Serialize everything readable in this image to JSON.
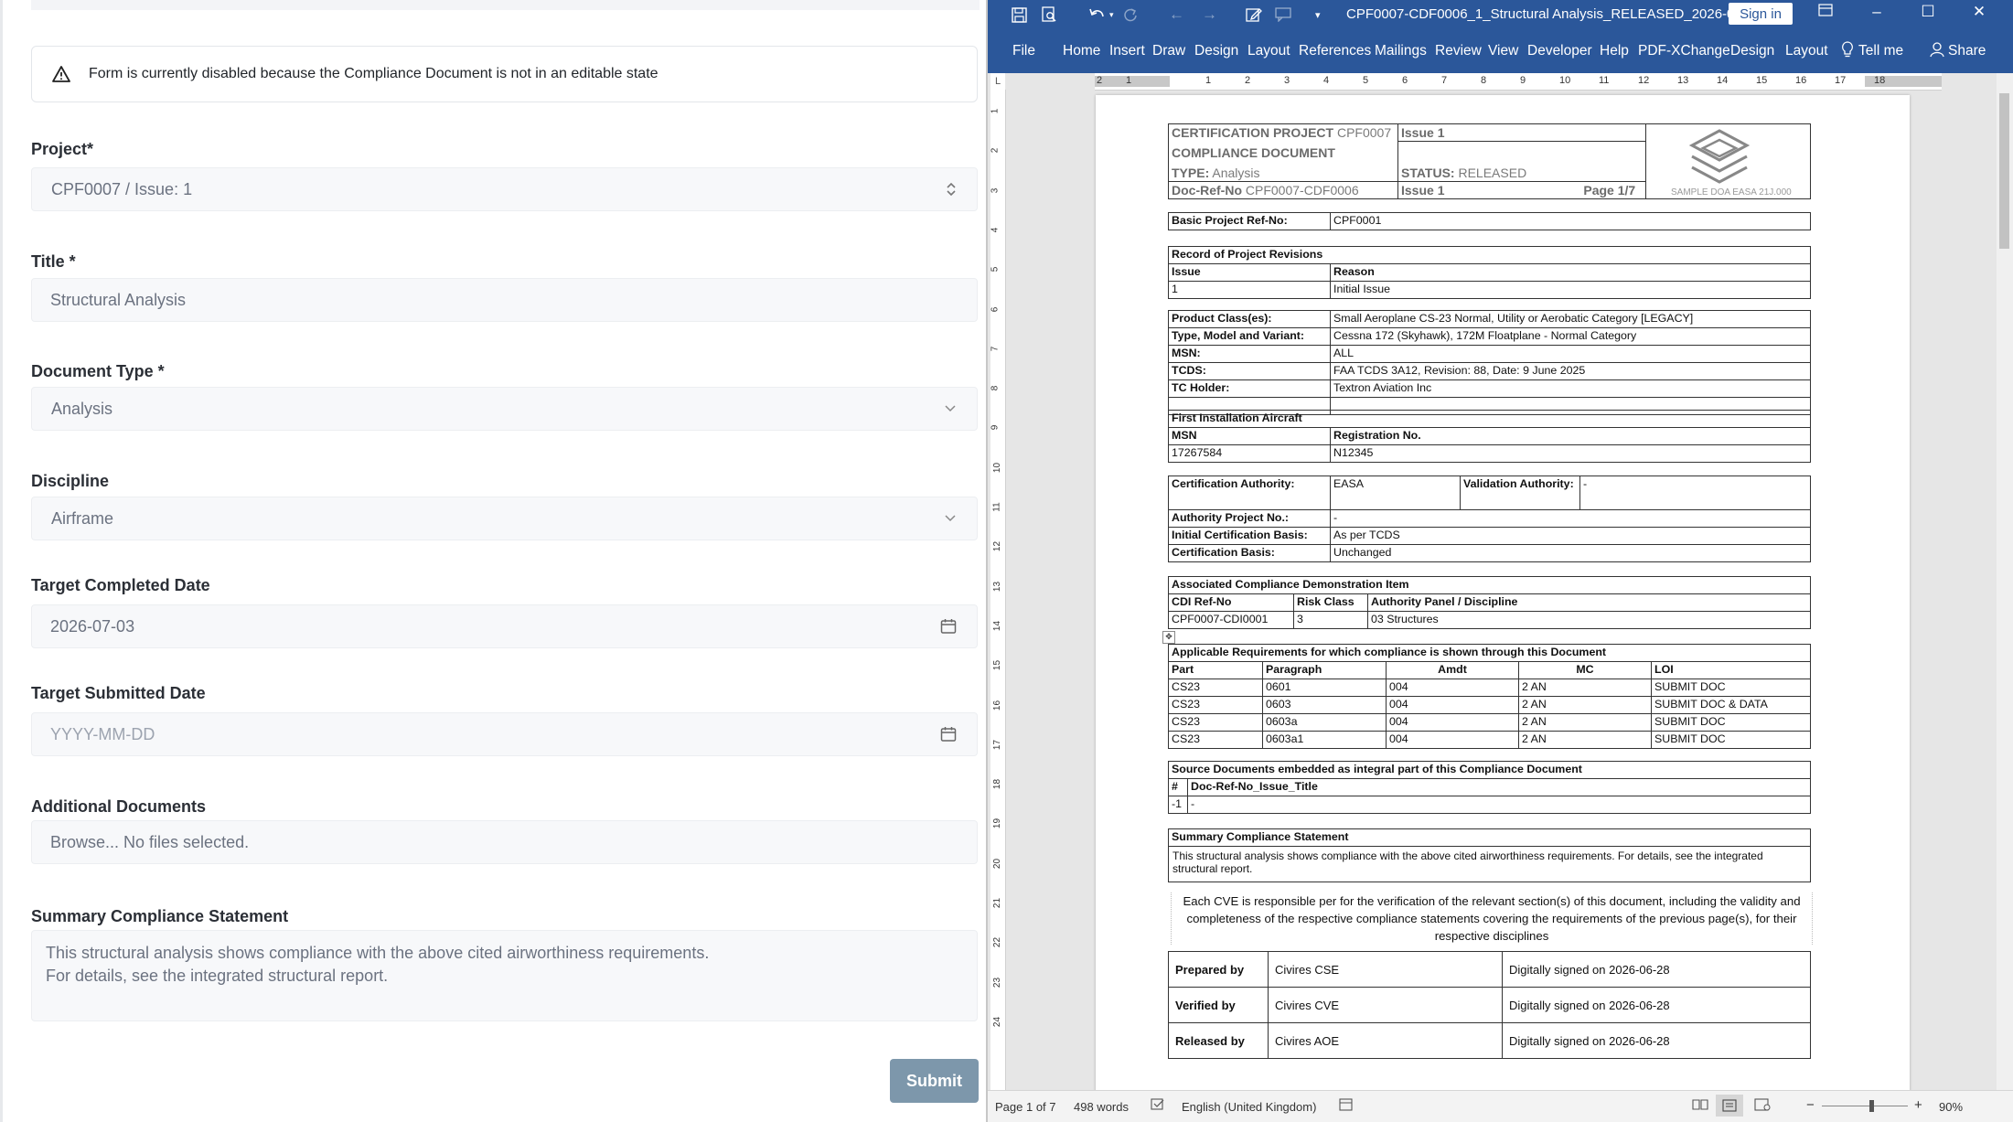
{
  "form": {
    "alert_text": "Form is currently disabled because the Compliance Document is not in an editable state",
    "project_label": "Project*",
    "project_value": "CPF0007 / Issue: 1",
    "title_label": "Title *",
    "title_value": "Structural Analysis",
    "doctype_label": "Document Type *",
    "doctype_value": "Analysis",
    "discipline_label": "Discipline",
    "discipline_value": "Airframe",
    "tcd_label": "Target Completed Date",
    "tcd_value": "2026-07-03",
    "tsd_label": "Target Submitted Date",
    "tsd_placeholder": "YYYY-MM-DD",
    "addl_label": "Additional Documents",
    "addl_value": "Browse... No files selected.",
    "summary_label": "Summary Compliance Statement",
    "summary_value": "This structural analysis shows compliance with the above cited airworthiness requirements.\nFor details, see the integrated structural report.",
    "submit_label": "Submit"
  },
  "word": {
    "doc_title": "CPF0007-CDF0006_1_Structural Analysis_RELEASED_2026-0...",
    "sign_in": "Sign in",
    "tabs": [
      "File",
      "Home",
      "Insert",
      "Draw",
      "Design",
      "Layout",
      "References",
      "Mailings",
      "Review",
      "View",
      "Developer",
      "Help",
      "PDF-XChange",
      "Design",
      "Layout"
    ],
    "tell_me": "Tell me",
    "share": "Share",
    "status": {
      "page": "Page 1 of 7",
      "words": "498 words",
      "language": "English (United Kingdom)",
      "zoom": "90%"
    },
    "ruler_h": [
      "2",
      "1",
      "1",
      "2",
      "3",
      "4",
      "5",
      "6",
      "7",
      "8",
      "9",
      "10",
      "11",
      "12",
      "13",
      "14",
      "15",
      "16",
      "17",
      "18"
    ],
    "ruler_v": [
      "1",
      "2",
      "3",
      "4",
      "5",
      "6",
      "7",
      "8",
      "9",
      "10",
      "11",
      "12",
      "13",
      "14",
      "15",
      "16",
      "17",
      "18",
      "19",
      "20",
      "21",
      "22",
      "23",
      "24"
    ]
  },
  "doc": {
    "h1a": "CERTIFICATION PROJECT",
    "h1b": "CPF0007",
    "h1c": "Issue 1",
    "h2": "COMPLIANCE DOCUMENT",
    "h3a": "TYPE:",
    "h3b": "Analysis",
    "h3c": "STATUS:",
    "h3d": "RELEASED",
    "h4a": "Doc-Ref-No",
    "h4b": "CPF0007-CDF0006",
    "h4c": "Issue 1",
    "h4d": "Page 1/7",
    "sample_text": "SAMPLE DOA EASA 21J.000",
    "basic_label": "Basic Project Ref-No:",
    "basic_value": "CPF0001",
    "revisions_title": "Record of Project Revisions",
    "rev_h1": "Issue",
    "rev_h2": "Reason",
    "rev_v1": "1",
    "rev_v2": "Initial Issue",
    "product": [
      [
        "Product Class(es):",
        "Small Aeroplane CS-23 Normal, Utility or Aerobatic Category [LEGACY]"
      ],
      [
        "Type, Model and Variant:",
        "Cessna 172 (Skyhawk), 172M Floatplane - Normal Category"
      ],
      [
        "MSN:",
        "ALL"
      ],
      [
        "TCDS:",
        "FAA TCDS 3A12, Revision: 88, Date: 9 June 2025"
      ],
      [
        "TC Holder:",
        "Textron Aviation Inc"
      ]
    ],
    "fia_title": "First Installation Aircraft",
    "fia_h1": "MSN",
    "fia_h2": "Registration No.",
    "fia_v1": "17267584",
    "fia_v2": "N12345",
    "auth_label": "Certification Authority:",
    "auth_value": "EASA",
    "val_label": "Validation Authority:",
    "val_value": "-",
    "apn_label": "Authority Project No.:",
    "apn_value": "-",
    "icb_label": "Initial Certification Basis:",
    "icb_value": "As per TCDS",
    "cb_label": "Certification Basis:",
    "cb_value": "Unchanged",
    "acdi_title": "Associated Compliance Demonstration Item",
    "acdi_h": [
      "CDI Ref-No",
      "Risk Class",
      "Authority Panel / Discipline"
    ],
    "acdi_v": [
      "CPF0007-CDI0001",
      "3",
      "03 Structures"
    ],
    "req_title": "Applicable Requirements for which compliance is shown through this Document",
    "req_h": [
      "Part",
      "Paragraph",
      "Amdt",
      "MC",
      "LOI"
    ],
    "req_rows": [
      [
        "CS23",
        "0601",
        "004",
        "2 AN",
        "SUBMIT DOC"
      ],
      [
        "CS23",
        "0603",
        "004",
        "2 AN",
        "SUBMIT DOC & DATA"
      ],
      [
        "CS23",
        "0603a",
        "004",
        "2 AN",
        "SUBMIT DOC"
      ],
      [
        "CS23",
        "0603a1",
        "004",
        "2 AN",
        "SUBMIT DOC"
      ]
    ],
    "src_title": "Source Documents embedded as integral part of this Compliance Document",
    "src_h1": "#",
    "src_h2": "Doc-Ref-No_Issue_Title",
    "src_v1": "-1",
    "src_v2": "-",
    "scs_title": "Summary Compliance Statement",
    "scs_text1": "This structural analysis shows compliance with the above cited airworthiness requirements. For details, see the integrated",
    "scs_text2": "structural report.",
    "cve_text": "Each CVE is responsible per for the verification of the relevant section(s) of this document, including the validity and completeness of the respective compliance statements covering the requirements of the previous page(s), for their respective disciplines",
    "sign": [
      [
        "Prepared by",
        "Civires CSE",
        "Digitally signed on 2026-06-28"
      ],
      [
        "Verified by",
        "Civires CVE",
        "Digitally signed on 2026-06-28"
      ],
      [
        "Released by",
        "Civires AOE",
        "Digitally signed on 2026-06-28"
      ]
    ]
  }
}
